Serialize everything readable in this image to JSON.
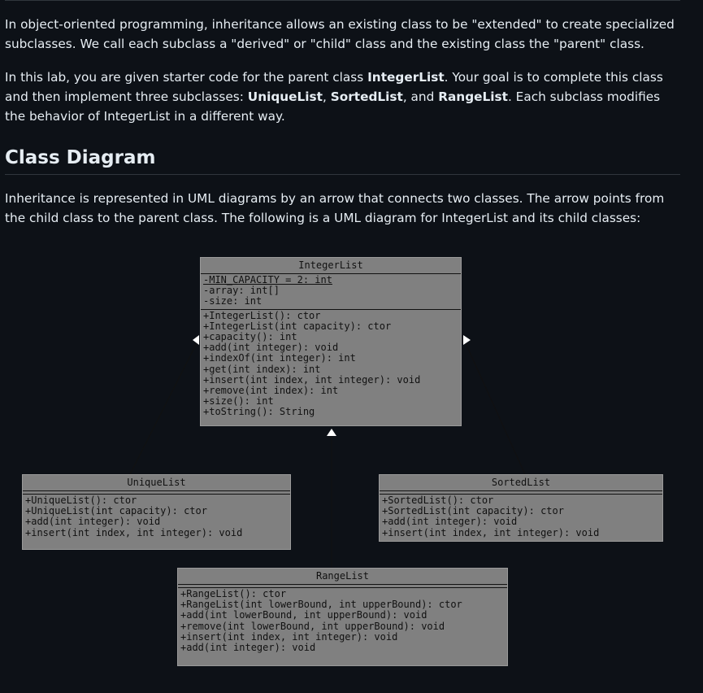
{
  "intro": {
    "p1": "In object-oriented programming, inheritance allows an existing class to be \"extended\" to create specialized subclasses. We call each subclass a \"derived\" or \"child\" class and the existing class the \"parent\" class.",
    "p2_a": "In this lab, you are given starter code for the parent class ",
    "p2_b": "IntegerList",
    "p2_c": ". Your goal is to complete this class and then implement three subclasses: ",
    "p2_d": "UniqueList",
    "p2_e": ", ",
    "p2_f": "SortedList",
    "p2_g": ", and ",
    "p2_h": "RangeList",
    "p2_i": ". Each subclass modifies the behavior of IntegerList in a different way."
  },
  "heading": "Class Diagram",
  "diagram_intro": "Inheritance is represented in UML diagrams by an arrow that connects two classes. The arrow points from the child class to the parent class. The following is a UML diagram for IntegerList and its child classes:",
  "diagram": {
    "integerlist": {
      "name": "IntegerList",
      "fields": [
        "-MIN_CAPACITY = 2: int",
        "-array: int[]",
        "-size: int"
      ],
      "methods": [
        "+IntegerList(): ctor",
        "+IntegerList(int capacity): ctor",
        "+capacity(): int",
        "+add(int integer): void",
        "+indexOf(int integer): int",
        "+get(int index): int",
        "+insert(int index, int integer): void",
        "+remove(int index): int",
        "+size(): int",
        "+toString(): String"
      ]
    },
    "uniquelist": {
      "name": "UniqueList",
      "methods": [
        "+UniqueList(): ctor",
        "+UniqueList(int capacity): ctor",
        "+add(int integer): void",
        "+insert(int index, int integer): void"
      ]
    },
    "sortedlist": {
      "name": "SortedList",
      "methods": [
        "+SortedList(): ctor",
        "+SortedList(int capacity): ctor",
        "+add(int integer): void",
        "+insert(int index, int integer): void"
      ]
    },
    "rangelist": {
      "name": "RangeList",
      "methods": [
        "+RangeList(): ctor",
        "+RangeList(int lowerBound, int upperBound): ctor",
        "+add(int lowerBound, int upperBound): void",
        "+remove(int lowerBound, int upperBound): void",
        "+insert(int index, int integer): void",
        "+add(int integer): void"
      ]
    }
  }
}
